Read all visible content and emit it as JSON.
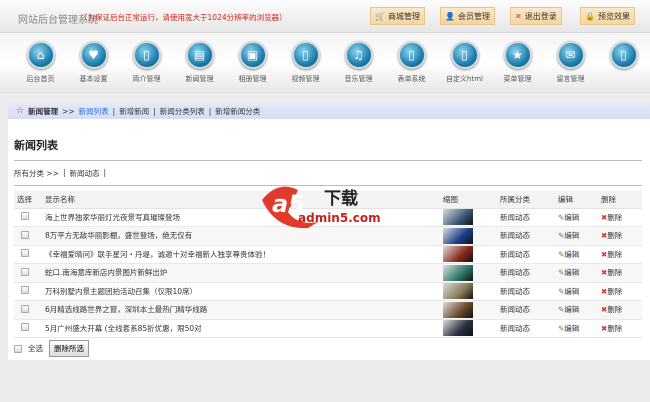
{
  "header": {
    "title": "网站后台管理系统",
    "notice": "（为保证后台正常运行，请使用宽大于1024分辨率的浏览器）",
    "buttons": [
      {
        "label": "商城管理",
        "icon": "cart-icon"
      },
      {
        "label": "会员管理",
        "icon": "user-icon"
      },
      {
        "label": "退出登录",
        "icon": "close-icon"
      },
      {
        "label": "预览效果",
        "icon": "preview-icon"
      }
    ]
  },
  "nav": [
    {
      "label": "后台首页",
      "g": "⌂"
    },
    {
      "label": "基本设置",
      "g": "♥"
    },
    {
      "label": "简介管理",
      "g": "▯"
    },
    {
      "label": "新闻管理",
      "g": "▤"
    },
    {
      "label": "相册管理",
      "g": "▣"
    },
    {
      "label": "视频管理",
      "g": "▯"
    },
    {
      "label": "音乐管理",
      "g": "♫"
    },
    {
      "label": "表单系统",
      "g": "▯"
    },
    {
      "label": "自定义html",
      "g": "▯"
    },
    {
      "label": "菜单管理",
      "g": "★"
    },
    {
      "label": "留言管理",
      "g": "✉"
    },
    {
      "label": "",
      "g": "▯"
    }
  ],
  "breadcrumb": {
    "section": "新闻管理",
    "sep": ">>",
    "active": "新闻列表",
    "links": [
      "新增新闻",
      "新闻分类列表",
      "新增新闻分类"
    ]
  },
  "page_title": "新闻列表",
  "category_path": {
    "root": "所有分类 >>",
    "items": [
      "新闻动态"
    ]
  },
  "table": {
    "headers": [
      "选择",
      "显示名称",
      "缩图",
      "所属分类",
      "编辑",
      "删除"
    ],
    "rows": [
      {
        "name": "海上世界独家华丽灯光夜景写真璀璨登场",
        "category": "新闻动态",
        "thumb": "#3a5a7a"
      },
      {
        "name": "8万平方无敌华丽影棚，盛世登场，绝无仅有",
        "category": "新闻动态",
        "thumb": "#1a3e8a"
      },
      {
        "name": "《幸福爱晴问》联手星河・丹堤，诚邀十对幸福新人独享尊贵体验！",
        "category": "新闻动态",
        "thumb": "#8a2a1a"
      },
      {
        "name": "蛇口.南海意库新店内景图片新鲜出炉",
        "category": "新闻动态",
        "thumb": "#2a7a6a"
      },
      {
        "name": "万科别墅内景主题团拍活动召集（仅限10席）",
        "category": "新闻动态",
        "thumb": "#8a7a5a"
      },
      {
        "name": "6月精选线路世界之窗，深圳本土最热门精华线路",
        "category": "新闻动态",
        "thumb": "#6a4a2a"
      },
      {
        "name": "5月广州盛大开幕 (全线套系85折优惠，限50对",
        "category": "新闻动态",
        "thumb": "#2a3040"
      }
    ],
    "edit_label": "编辑",
    "delete_label": "删除"
  },
  "footer": {
    "select_all": "全选",
    "delete_selected": "删除所选"
  },
  "watermark": {
    "logo": "a5下载",
    "site": "admin5.com"
  },
  "colors": {
    "accent": "#d0231a",
    "link": "#2a6ed6",
    "breadcrumb_bg": "#dde3f7"
  }
}
